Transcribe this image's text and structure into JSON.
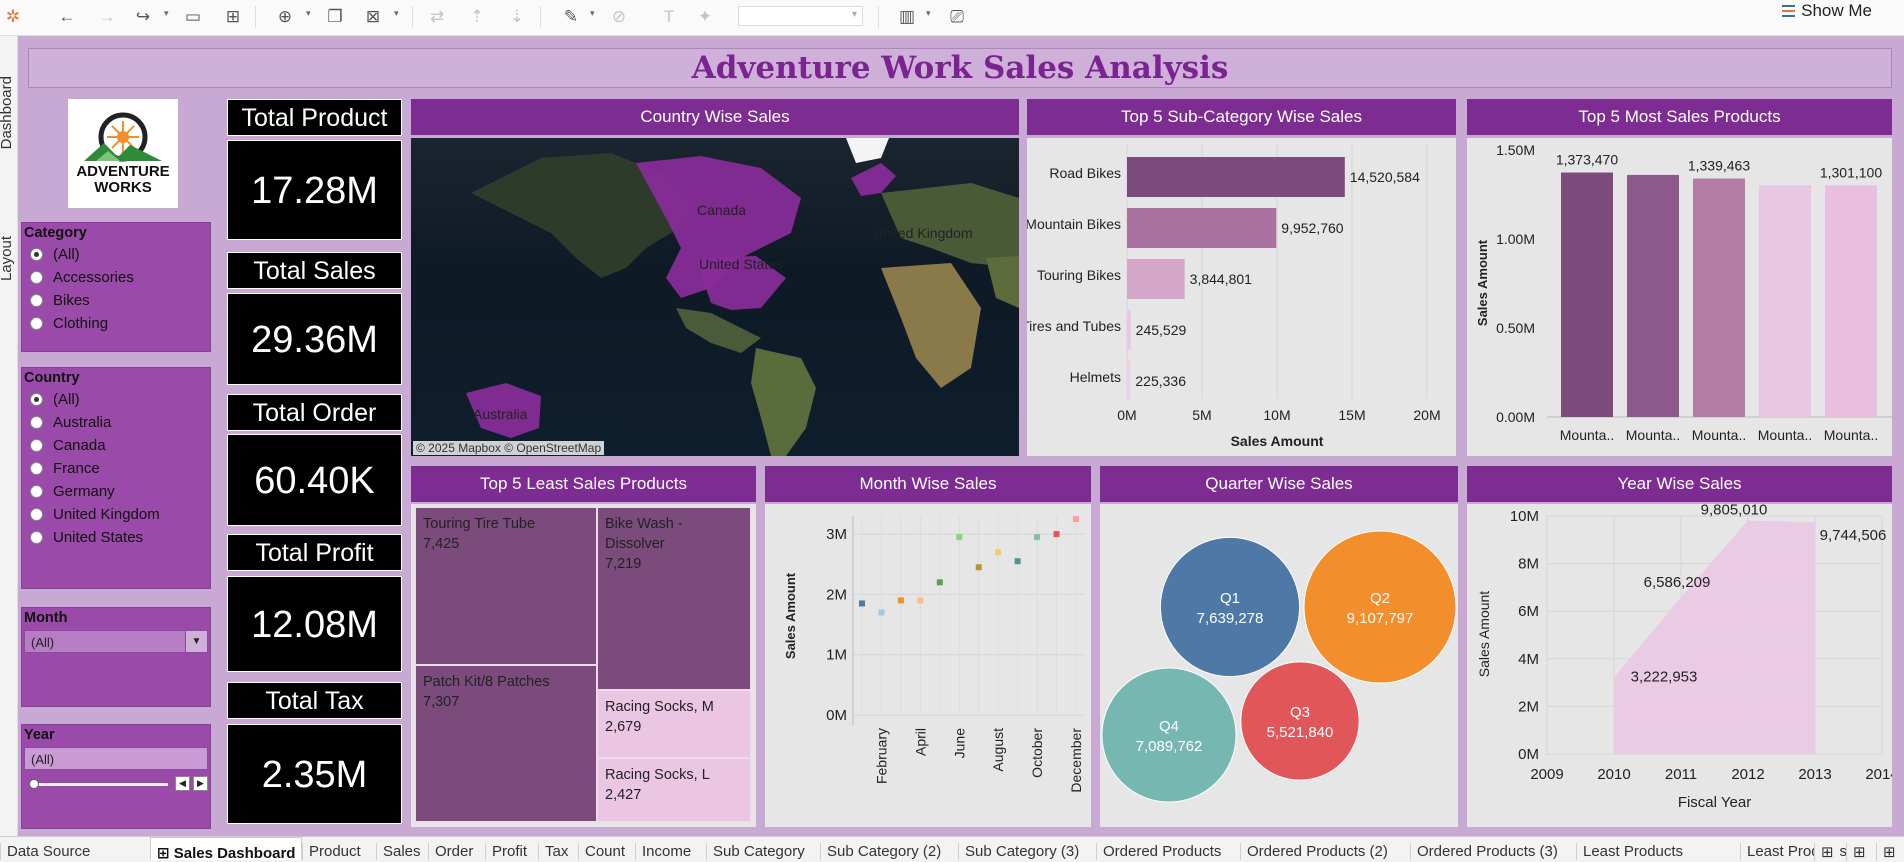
{
  "colors": {
    "purple_header": "#7d2c91",
    "filter_panel": "#9a4aa8",
    "dashboard_bg": "#c8a9d3",
    "title_text": "#7a2391",
    "kpi_bg": "#000000",
    "q1": "#4e79a7",
    "q2": "#f28e2b",
    "q3": "#e15759",
    "q4": "#76b7b2"
  },
  "toolbar": {
    "icons": [
      "tableau-logo-icon",
      "undo-icon",
      "redo-icon",
      "replay-icon",
      "save-icon",
      "new-data-source-icon",
      "new-worksheet-icon",
      "duplicate-sheet-icon",
      "clear-sheet-icon",
      "swap-icon",
      "sort-ascending-icon",
      "sort-descending-icon",
      "highlight-icon",
      "group-icon",
      "label-icon",
      "pin-icon",
      "fit-select",
      "chart-type-icon",
      "presentation-icon"
    ],
    "show_me": "Show Me"
  },
  "side_tabs": [
    "Dashboard",
    "Layout"
  ],
  "title": "Adventure Work Sales Analysis",
  "logo": {
    "line1": "ADVENTURE",
    "line2": "WORKS"
  },
  "filters": {
    "category": {
      "label": "Category",
      "options": [
        "(All)",
        "Accessories",
        "Bikes",
        "Clothing"
      ],
      "selected": "(All)"
    },
    "country": {
      "label": "Country",
      "options": [
        "(All)",
        "Australia",
        "Canada",
        "France",
        "Germany",
        "United Kingdom",
        "United States"
      ],
      "selected": "(All)"
    },
    "month": {
      "label": "Month",
      "value": "(All)"
    },
    "year": {
      "label": "Year",
      "value": "(All)"
    }
  },
  "kpis": [
    {
      "label": "Total Product",
      "value": "17.28M"
    },
    {
      "label": "Total Sales",
      "value": "29.36M"
    },
    {
      "label": "Total Order",
      "value": "60.40K"
    },
    {
      "label": "Total Profit",
      "value": "12.08M"
    },
    {
      "label": "Total Tax",
      "value": "2.35M"
    }
  ],
  "country_map": {
    "title": "Country Wise Sales",
    "labels": [
      "Canada",
      "United States",
      "United Kingdom",
      "Australia"
    ],
    "attribution": "© 2025 Mapbox © OpenStreetMap"
  },
  "chart_data": [
    {
      "id": "subcat",
      "type": "bar",
      "title": "Top 5 Sub-Category Wise Sales",
      "orientation": "horizontal",
      "categories": [
        "Road Bikes",
        "Mountain Bikes",
        "Touring Bikes",
        "Tires and Tubes",
        "Helmets"
      ],
      "values": [
        14520584,
        9952760,
        3844801,
        245529,
        225336
      ],
      "value_labels": [
        "14,520,584",
        "9,952,760",
        "3,844,801",
        "245,529",
        "225,336"
      ],
      "colors": [
        "#7b4b7c",
        "#a9719f",
        "#d4a7ca",
        "#e9c6e1",
        "#ecd0e6"
      ],
      "xlabel": "Sales Amount",
      "xlim": [
        0,
        20000000
      ],
      "xticks": [
        "0M",
        "5M",
        "10M",
        "15M",
        "20M"
      ],
      "grid": true
    },
    {
      "id": "topprod",
      "type": "bar",
      "title": "Top 5 Most Sales Products",
      "categories": [
        "Mounta..",
        "Mounta..",
        "Mounta..",
        "Mounta..",
        "Mounta.."
      ],
      "values": [
        1373470,
        1360000,
        1339463,
        1301100,
        1301100
      ],
      "value_labels": [
        "1,373,470",
        "",
        "1,339,463",
        "",
        "1,301,100"
      ],
      "colors": [
        "#7b4b7c",
        "#8c5a8a",
        "#b27ca6",
        "#e9c6e1",
        "#e8bfe0"
      ],
      "ylabel": "Sales Amount",
      "ylim": [
        0,
        1500000
      ],
      "yticks": [
        "0.00M",
        "0.50M",
        "1.00M",
        "1.50M"
      ]
    },
    {
      "id": "leastprod",
      "type": "treemap",
      "title": "Top 5 Least Sales Products",
      "items": [
        {
          "name": "Touring Tire Tube",
          "value": "7,425",
          "color": "#7b4b7c"
        },
        {
          "name": "Bike Wash - Dissolver",
          "value": "7,219",
          "color": "#7b4b7c"
        },
        {
          "name": "Patch Kit/8 Patches",
          "value": "7,307",
          "color": "#7b4b7c"
        },
        {
          "name": "Racing Socks, M",
          "value": "2,679",
          "color": "#ebc6e3"
        },
        {
          "name": "Racing Socks, L",
          "value": "2,427",
          "color": "#ebc6e3"
        }
      ]
    },
    {
      "id": "month",
      "type": "scatter",
      "title": "Month Wise Sales",
      "x": [
        "January",
        "February",
        "March",
        "April",
        "May",
        "June",
        "July",
        "August",
        "September",
        "October",
        "November",
        "December"
      ],
      "xticks": [
        "February",
        "April",
        "June",
        "August",
        "October",
        "December"
      ],
      "y": [
        1850000,
        1700000,
        1900000,
        1900000,
        2200000,
        2950000,
        2450000,
        2700000,
        2550000,
        2950000,
        3000000,
        3250000
      ],
      "colors": [
        "#4e79a7",
        "#a0cbe8",
        "#f28e2b",
        "#ffbe7d",
        "#59a14f",
        "#8cd17d",
        "#b6992d",
        "#f1ce63",
        "#499894",
        "#86bcb6",
        "#e15759",
        "#ff9d9a"
      ],
      "ylabel": "Sales Amount",
      "ylim": [
        0,
        3300000
      ],
      "yticks": [
        "0M",
        "1M",
        "2M",
        "3M"
      ]
    },
    {
      "id": "quarter",
      "type": "packed-bubbles",
      "title": "Quarter Wise Sales",
      "categories": [
        "Q1",
        "Q2",
        "Q3",
        "Q4"
      ],
      "values": [
        7639278,
        9107797,
        5521840,
        7089762
      ],
      "value_labels": [
        "7,639,278",
        "9,107,797",
        "5,521,840",
        "7,089,762"
      ]
    },
    {
      "id": "year",
      "type": "area",
      "title": "Year Wise Sales",
      "x": [
        2010,
        2011,
        2012,
        2013
      ],
      "y": [
        3222953,
        6586209,
        9805010,
        9744506
      ],
      "value_labels": [
        "3,222,953",
        "6,586,209",
        "9,805,010",
        "9,744,506"
      ],
      "xticks": [
        "2009",
        "2010",
        "2011",
        "2012",
        "2013",
        "2014"
      ],
      "xlim": [
        2009,
        2014
      ],
      "xlabel": "Fiscal Year",
      "ylabel": "Sales Amount",
      "ylim": [
        0,
        10000000
      ],
      "yticks": [
        "0M",
        "2M",
        "4M",
        "6M",
        "8M",
        "10M"
      ],
      "color": "#ebc6e3"
    }
  ],
  "sheet_tabs": [
    "Data Source",
    "Sales Dashboard",
    "Product",
    "Sales",
    "Order",
    "Profit",
    "Tax",
    "Count",
    "Income",
    "Sub Category",
    "Sub Category (2)",
    "Sub Category (3)",
    "Ordered Products",
    "Ordered Products (2)",
    "Ordered Products (3)",
    "Least Products",
    "Least Products"
  ],
  "active_tab": "Sales Dashboard"
}
